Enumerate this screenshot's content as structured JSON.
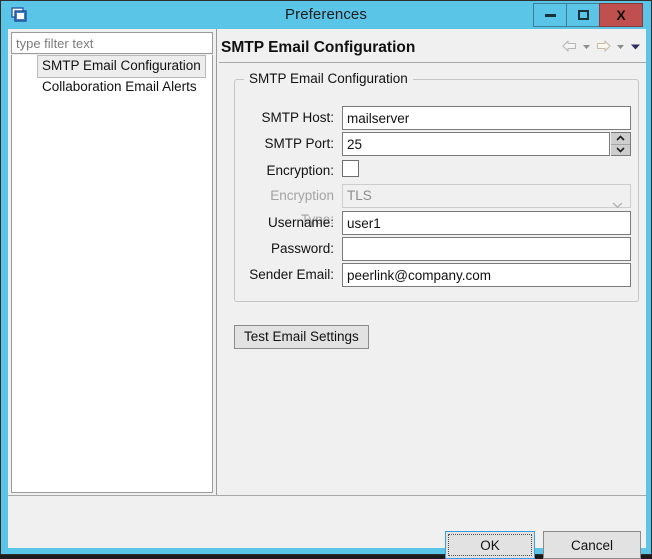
{
  "window": {
    "title": "Preferences",
    "icon": "preferences-folder-icon",
    "frame_color": "#5bc5e8",
    "controls": {
      "minimize": "minimize-button",
      "maximize": "maximize-button",
      "close_label": "X"
    }
  },
  "sidebar": {
    "filter": {
      "placeholder": "type filter text",
      "value": ""
    },
    "items": [
      {
        "label": "SMTP Email Configuration",
        "selected": true
      },
      {
        "label": "Collaboration Email Alerts",
        "selected": false
      }
    ]
  },
  "main": {
    "page_title": "SMTP Email Configuration",
    "nav": {
      "back": "back-arrow-icon",
      "back_menu": "back-dropdown-icon",
      "forward": "forward-arrow-icon",
      "forward_menu": "forward-dropdown-icon",
      "menu": "page-menu-chevron-icon"
    },
    "group": {
      "title": "SMTP Email Configuration",
      "fields": [
        {
          "label": "SMTP Host:",
          "value": "mailserver",
          "type": "text"
        },
        {
          "label": "SMTP Port:",
          "value": "25",
          "type": "spinner"
        },
        {
          "label": "Encryption:",
          "value": "",
          "type": "checkbox",
          "checked": false
        },
        {
          "label": "Encryption Type:",
          "value": "TLS",
          "type": "select",
          "disabled": true
        },
        {
          "label": "Username:",
          "value": "user1",
          "type": "text"
        },
        {
          "label": "Password:",
          "value": "",
          "type": "password"
        },
        {
          "label": "Sender Email:",
          "value": "peerlink@company.com",
          "type": "text"
        }
      ]
    },
    "test_button": "Test Email Settings"
  },
  "footer": {
    "ok": "OK",
    "cancel": "Cancel"
  }
}
